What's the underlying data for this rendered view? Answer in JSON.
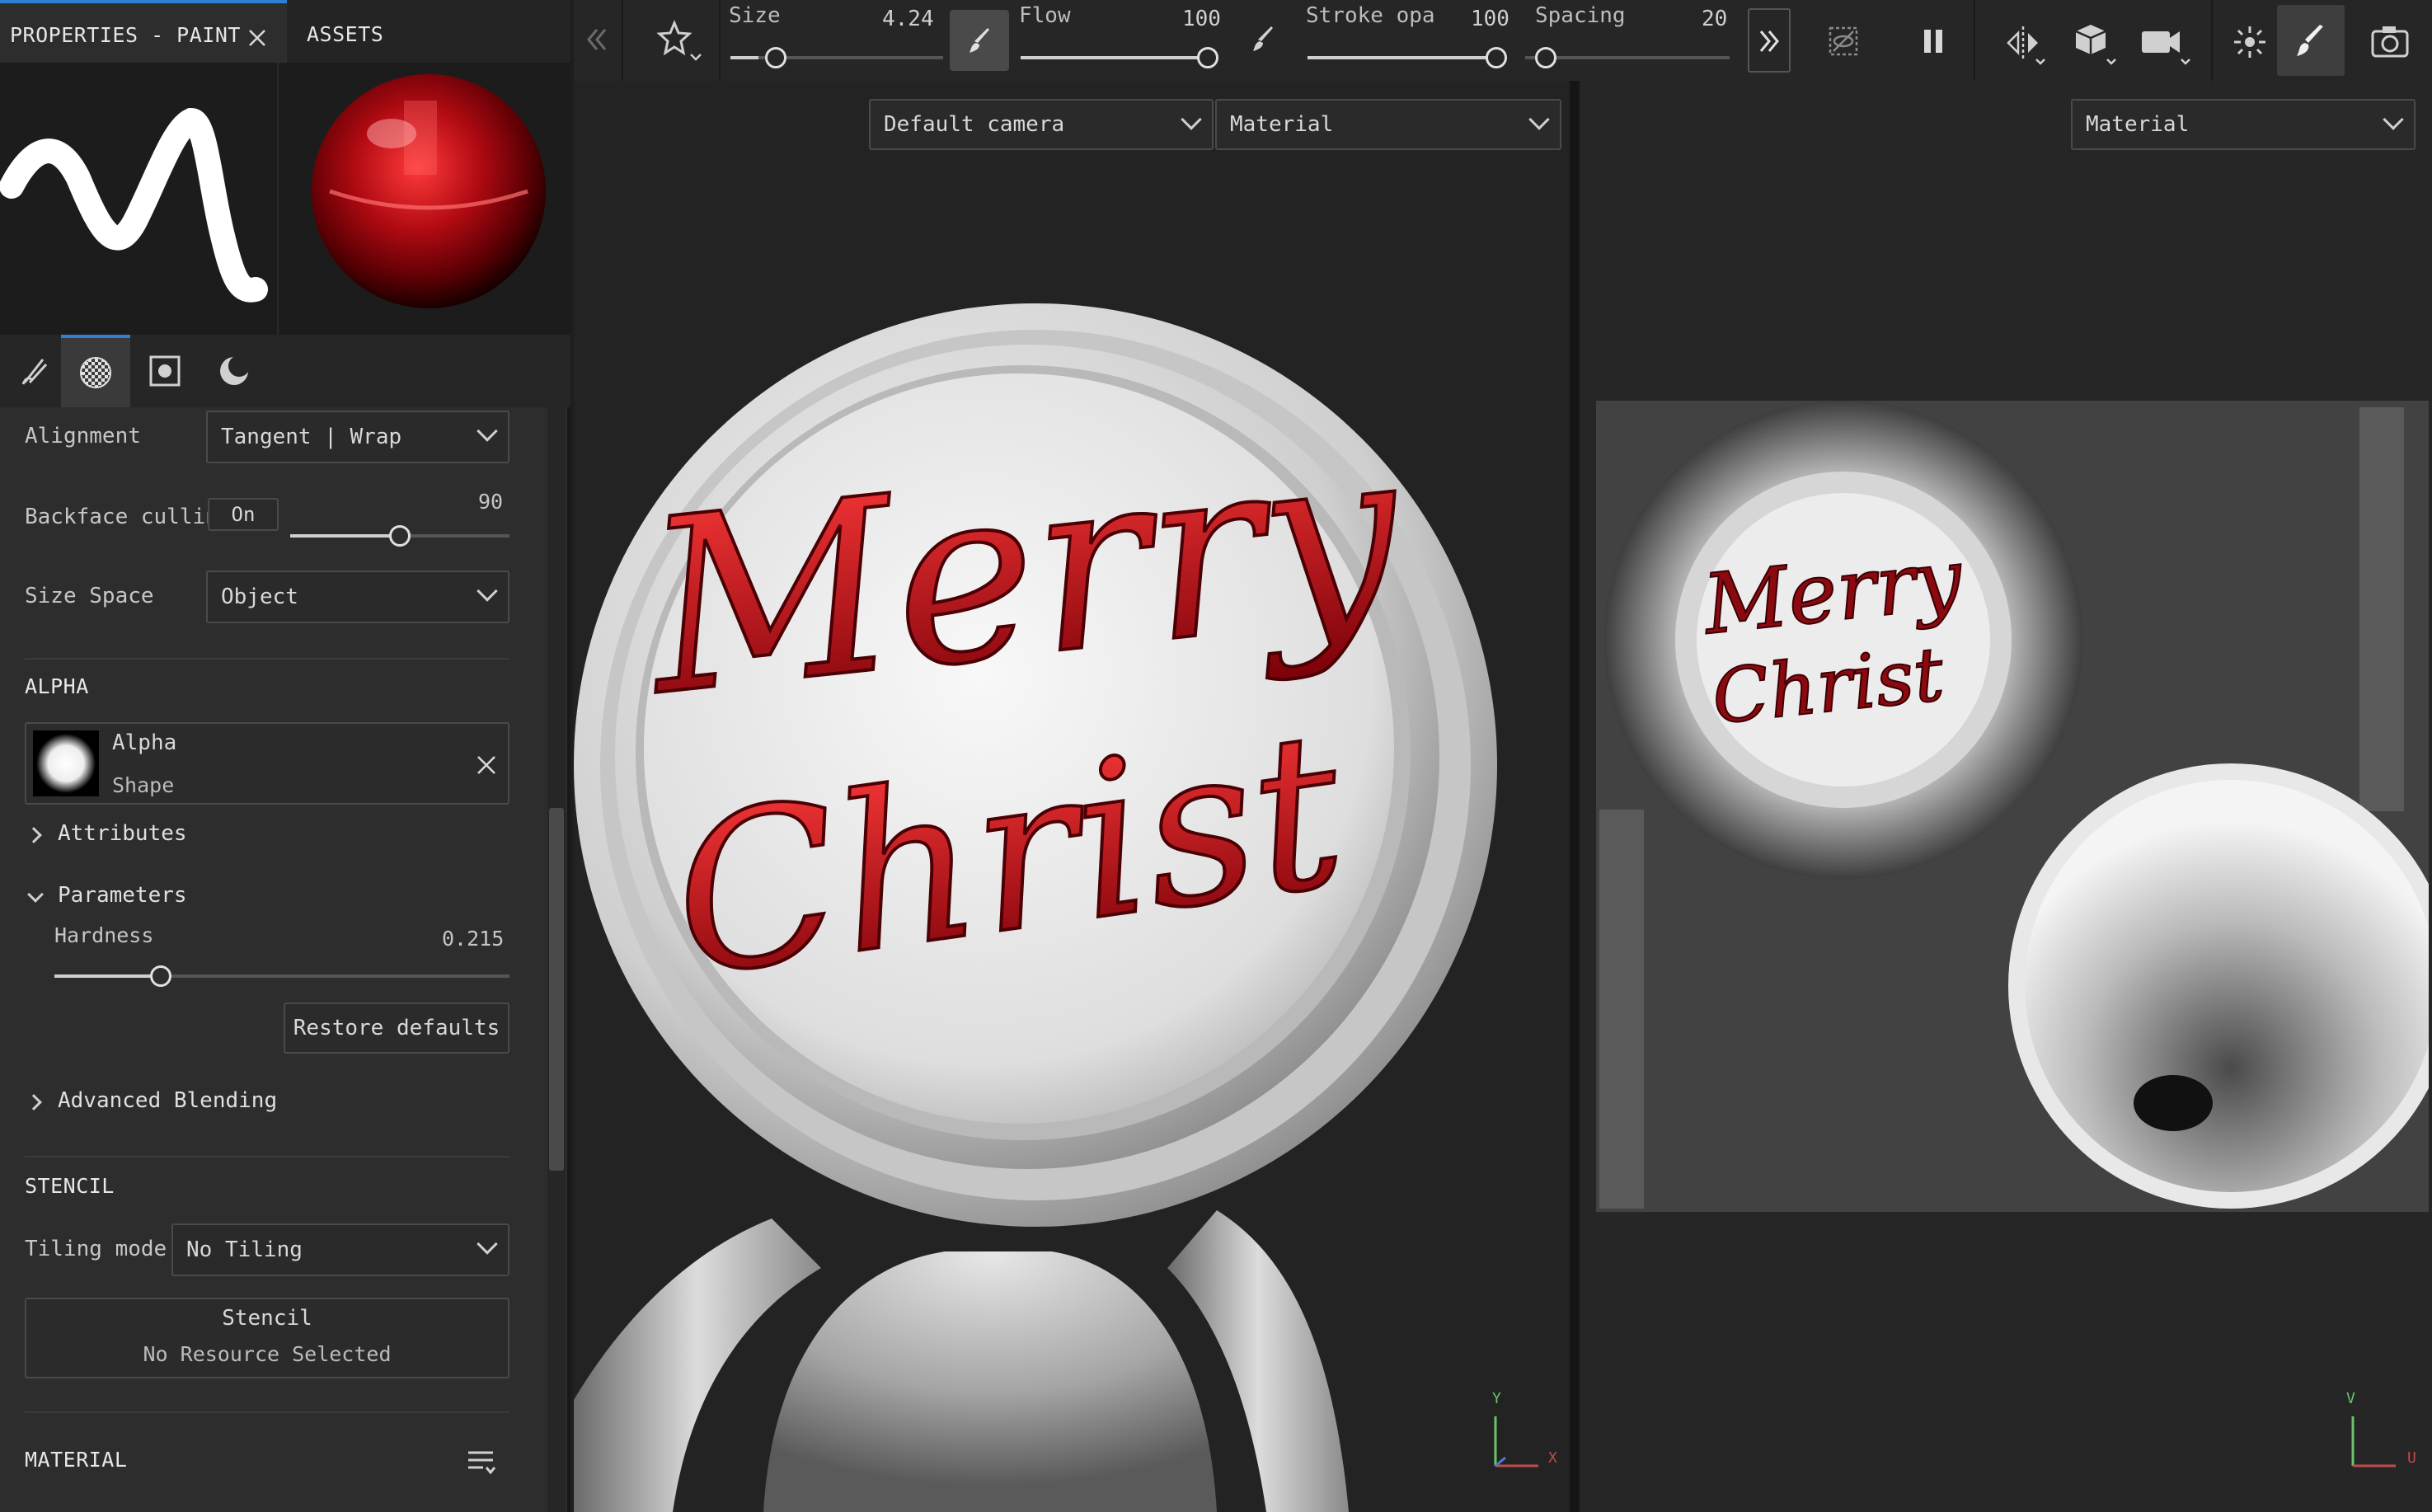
{
  "tabs": [
    {
      "label": "PROPERTIES - PAINT",
      "active": true
    },
    {
      "label": "ASSETS",
      "active": false
    }
  ],
  "icons": {
    "tab_close": "close-icon",
    "tools": [
      "brush-tool-icon",
      "alpha-checker-icon",
      "stencil-square-icon",
      "material-sphere-icon"
    ],
    "toolbar": [
      "stencil-star-icon",
      "pressure-brush-icon",
      "flow-brush-icon",
      "collapse-left-icon",
      "expand-right-icon",
      "hide-icon",
      "pause-icon",
      "symmetry-icon",
      "cube-icon",
      "camera-icon",
      "lighting-icon",
      "paint-brush-icon",
      "screenshot-icon"
    ],
    "material_menu": "list-menu-icon"
  },
  "colors": {
    "accent": "#2f7fd3",
    "panel": "#2d2d2d",
    "viewport": "#232323",
    "paint_red": "#b0101a"
  },
  "properties": {
    "alignment": {
      "label": "Alignment",
      "value": "Tangent | Wrap"
    },
    "backface_culling": {
      "label": "Backface culling",
      "toggle": "On",
      "value": "90",
      "fraction": 0.5
    },
    "size_space": {
      "label": "Size Space",
      "value": "Object"
    }
  },
  "alpha": {
    "section": "ALPHA",
    "resource_name": "Alpha",
    "resource_sub": "Shape",
    "attributes": "Attributes",
    "parameters": "Parameters",
    "hardness": {
      "label": "Hardness",
      "value": "0.215",
      "fraction": 0.215
    },
    "restore": "Restore defaults",
    "advanced": "Advanced Blending"
  },
  "stencil": {
    "section": "STENCIL",
    "tiling_label": "Tiling mode",
    "tiling_value": "No Tiling",
    "resource_title": "Stencil",
    "resource_sub": "No Resource Selected"
  },
  "material": {
    "section": "MATERIAL"
  },
  "toolbar": {
    "size": {
      "label": "Size",
      "value": "4.24",
      "fraction": 0.1
    },
    "flow": {
      "label": "Flow",
      "value": "100",
      "fraction": 1.0
    },
    "stroke": {
      "label": "Stroke opa",
      "value": "100",
      "fraction": 1.0
    },
    "spacing": {
      "label": "Spacing",
      "value": "20",
      "fraction": 0.03
    }
  },
  "viewport3d": {
    "camera": "Default camera",
    "mode": "Material",
    "axis_y": "Y",
    "axis_x": "X"
  },
  "viewport2d": {
    "mode": "Material",
    "axis_v": "V",
    "axis_u": "U"
  },
  "canvas_text": {
    "line1": "Merry",
    "line2": "Christ",
    "small1": "Merry",
    "small2": "Christ"
  }
}
